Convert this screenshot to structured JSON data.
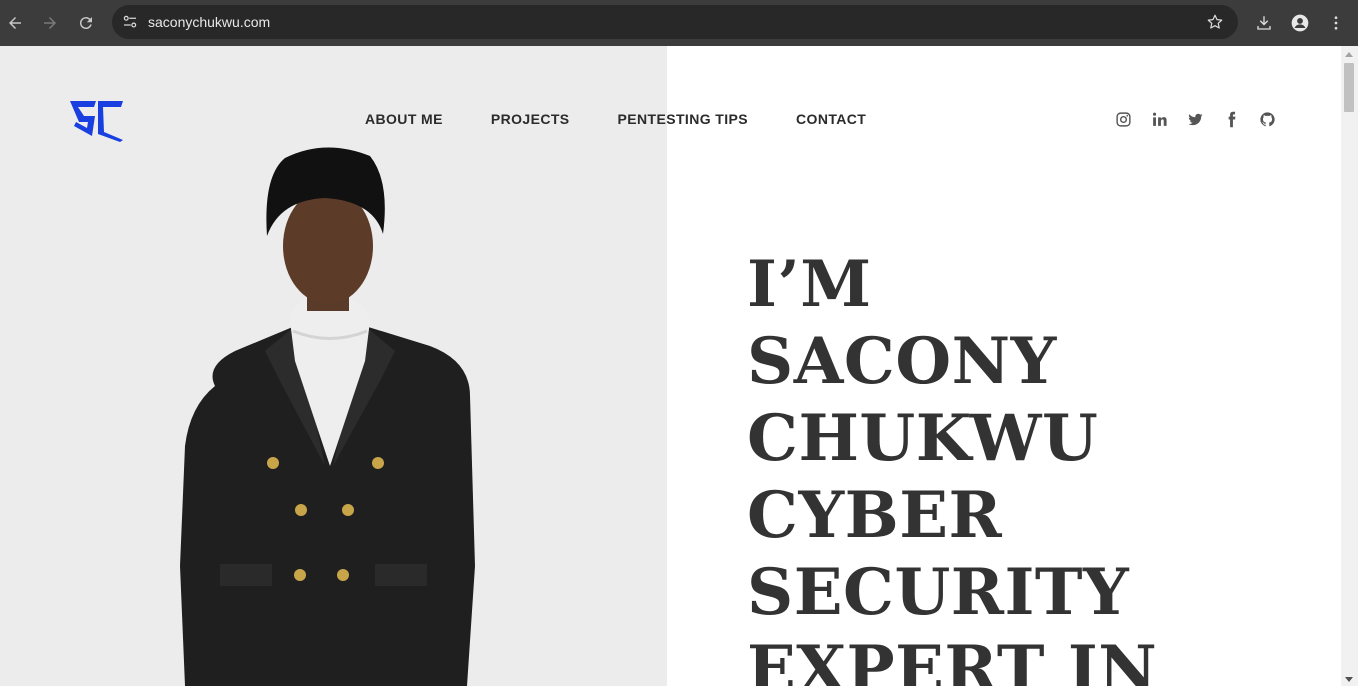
{
  "browser": {
    "url": "saconychukwu.com"
  },
  "site": {
    "logo_text": "SC",
    "nav": [
      {
        "label": "ABOUT ME"
      },
      {
        "label": "PROJECTS"
      },
      {
        "label": "PENTESTING TIPS"
      },
      {
        "label": "CONTACT"
      }
    ],
    "social": [
      "instagram-icon",
      "linkedin-icon",
      "twitter-icon",
      "facebook-icon",
      "github-icon"
    ],
    "headline_lines": [
      "I’M",
      "SACONY",
      "CHUKWU",
      "CYBER",
      "SECURITY",
      "EXPERT IN"
    ]
  },
  "colors": {
    "brand_blue": "#1a3fe0",
    "left_panel": "#ececec",
    "headline": "#333333"
  }
}
